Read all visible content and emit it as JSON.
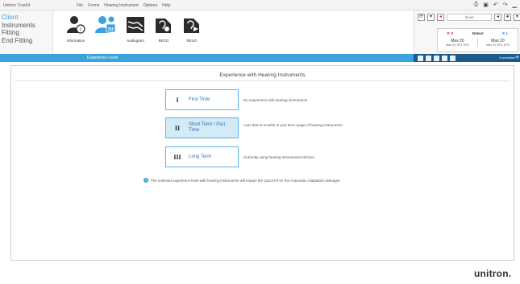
{
  "window": {
    "app_title": "Unitron TrueFit",
    "menu": [
      "File",
      "Forms",
      "Hearing Instrument",
      "Options",
      "Help"
    ]
  },
  "leftnav": {
    "items": [
      {
        "label": "Client",
        "active": true
      },
      {
        "label": "Instruments",
        "active": false
      },
      {
        "label": "Fitting",
        "active": false
      },
      {
        "label": "End Fitting",
        "active": false
      }
    ]
  },
  "toolbar": {
    "tools": [
      {
        "label": "Information",
        "icon": "information-icon"
      },
      {
        "label": "",
        "icon": "experience-level-icon"
      },
      {
        "label": "Audiogram",
        "icon": "audiogram-icon"
      },
      {
        "label": "RECD",
        "icon": "recd-icon"
      },
      {
        "label": "REUG",
        "icon": "reug-icon"
      }
    ]
  },
  "device_panel": {
    "quiet_label": "Quiet",
    "detect_label": "Detect",
    "right_label": "R ✕",
    "left_label": "✕ L",
    "right": {
      "model": "Max 20",
      "sub": "Max 20 SP1 BTE"
    },
    "left": {
      "model": "Max 20",
      "sub": "Max 20 SP1 BTE"
    },
    "connection_label": "Connection",
    "plus_label": "+"
  },
  "subbar": {
    "label": "Experience Level"
  },
  "main": {
    "title": "Experience with Hearing Instruments",
    "options": [
      {
        "numeral": "I",
        "label": "First Time",
        "description": "No experience with hearing instruments",
        "selected": false
      },
      {
        "numeral": "II",
        "label": "Short Term / Part Time",
        "description": "Less than 6 months or part time usage of hearing instruments",
        "selected": true
      },
      {
        "numeral": "III",
        "label": "Long Term",
        "description": "Currently using hearing instruments full time",
        "selected": false
      }
    ],
    "info_note": "The selected experience level with hearing instruments will impact the Quick Fit for the Automatic Adaptation Manager."
  },
  "brand": "unitron.",
  "colors": {
    "accent": "#3aa3dc",
    "dark_blue": "#1d5a8c",
    "right_ear": "#d92e2e",
    "left_ear": "#2d6fc2"
  }
}
